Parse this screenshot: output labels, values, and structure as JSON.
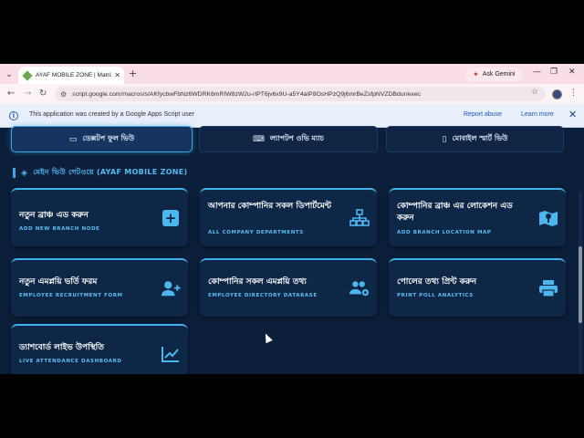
{
  "browser": {
    "tab_title": "AYAF MOBILE ZONE | Matrix Ne",
    "new_tab": "+",
    "ask_gemini": "Ask Gemini",
    "url": "script.google.com/macros/s/AKfycbwFbNz6WDRK6mRIW8zW2u-rIPT6jv6x9U-a5Y4aIP8OsHPzQ9j6mrBeZsfpNVZDBdur/exec"
  },
  "infobar": {
    "text": "This application was created by a Google Apps Script user",
    "report": "Report abuse",
    "learn": "Learn more"
  },
  "view_tabs": [
    {
      "label": "ডেক্সটপ ফুল ভিউ",
      "icon": "desktop-icon"
    },
    {
      "label": "ল্যাপটপ ওভি ম্যাচ",
      "icon": "laptop-icon"
    },
    {
      "label": "মোবাইল স্মার্ট ভিউ",
      "icon": "mobile-icon"
    }
  ],
  "section": {
    "title": "মেইন ভিউ গেটওয়ে (AYAF MOBILE ZONE)"
  },
  "cards": [
    {
      "title": "নতুন ব্রাঞ্চ এড করুন",
      "subtitle": "ADD NEW BRANCH NODE",
      "icon": "plus-box-icon"
    },
    {
      "title": "আপনার কোম্পানির সকল ডিপার্টমেন্ট",
      "subtitle": "ALL COMPANY DEPARTMENTS",
      "icon": "sitemap-icon"
    },
    {
      "title": "কোম্পানির ব্রাঞ্চ এর লোকেশন এড করুন",
      "subtitle": "ADD BRANCH LOCATION MAP",
      "icon": "map-location-icon"
    },
    {
      "title": "নতুন এমপ্লয়ি ভর্তি ফরম",
      "subtitle": "EMPLOYEE RECRUITMENT FORM",
      "icon": "add-user-icon"
    },
    {
      "title": "কোম্পানির সকল এমপ্লয়ি তথ্য",
      "subtitle": "EMPLOYEE DIRECTORY DATABASE",
      "icon": "users-gear-icon"
    },
    {
      "title": "পোলের তথ্য প্রিন্ট করুন",
      "subtitle": "PRINT POLL ANALYTICS",
      "icon": "printer-icon"
    },
    {
      "title": "ড্যাশবোর্ড লাইভ উপস্থিতি",
      "subtitle": "LIVE ATTENDANCE DASHBOARD",
      "icon": "chart-line-icon"
    }
  ],
  "colors": {
    "accent": "#3fb1ee",
    "page_bg": "#0b1f3a",
    "card_bg": "#0f2746"
  }
}
